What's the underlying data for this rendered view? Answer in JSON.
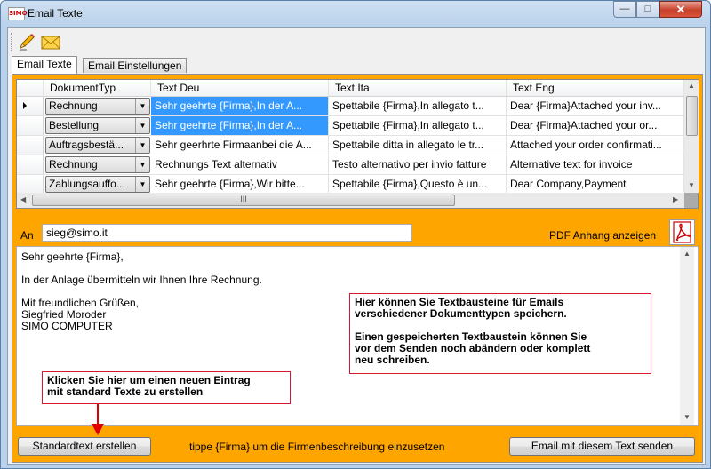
{
  "window": {
    "title": "Email Texte",
    "app_icon_text": "SIMO",
    "controls": {
      "minimize": "—",
      "maximize": "□",
      "close": "✕"
    }
  },
  "toolbar": {
    "items": [
      "edit-icon",
      "email-icon"
    ]
  },
  "tabs": [
    {
      "label": "Email Texte",
      "active": true
    },
    {
      "label": "Email Einstellungen",
      "active": false
    }
  ],
  "grid": {
    "columns": [
      "DokumentTyp",
      "Text Deu",
      "Text Ita",
      "Text Eng"
    ],
    "rows": [
      {
        "current": true,
        "typ": "Rechnung",
        "deu": "Sehr geehrte {Firma},In der A...",
        "ita": "Spettabile {Firma},In allegato t...",
        "eng": "Dear {Firma}Attached your inv..."
      },
      {
        "current": false,
        "typ": "Bestellung",
        "deu": "Sehr geehrte {Firma},In der A...",
        "ita": "Spettabile {Firma},In allegato t...",
        "eng": "Dear {Firma}Attached your or..."
      },
      {
        "current": false,
        "typ": "Auftragsbestä...",
        "deu": "Sehr geerhrte Firmaanbei die A...",
        "ita": "Spettabile ditta in allegato le tr...",
        "eng": "Attached your order confirmati..."
      },
      {
        "current": false,
        "typ": "Rechnung",
        "deu": "Rechnungs Text alternativ",
        "ita": "Testo alternativo per invio fatture",
        "eng": "Alternative text for invoice"
      },
      {
        "current": false,
        "typ": "Zahlungsauffo...",
        "deu": "Sehr geehrte {Firma},Wir bitte...",
        "ita": "Spettabile {Firma},Questo è un...",
        "eng": "Dear Company,Payment"
      }
    ],
    "hscroll_grip": "III"
  },
  "recipient": {
    "label": "An",
    "value": "sieg@simo.it"
  },
  "pdf": {
    "label": "PDF Anhang anzeigen"
  },
  "email_body": [
    "Sehr geehrte {Firma},",
    "",
    "In der Anlage übermitteln wir Ihnen Ihre Rechnung.",
    "",
    "Mit freundlichen Grüßen,",
    "Siegfried Moroder",
    "SIMO COMPUTER"
  ],
  "callouts": {
    "info": [
      "Hier können Sie Textbausteine für Emails",
      "verschiedener Dokumenttypen speichern.",
      "",
      "Einen gespeicherten Textbaustein können Sie",
      "vor dem Senden noch abändern oder komplett",
      "neu schreiben."
    ],
    "new_entry": [
      "Klicken Sie hier um einen neuen Eintrag",
      "mit standard Texte zu erstellen"
    ]
  },
  "footer": {
    "standard_button": "Standardtext erstellen",
    "hint": "tippe {Firma} um die Firmenbeschreibung einzusetzen",
    "send_button": "Email mit diesem Text senden"
  },
  "colors": {
    "panel": "#ffa500",
    "selection": "#3399ff",
    "callout_border": "#d9182d",
    "arrow": "#e00000"
  }
}
